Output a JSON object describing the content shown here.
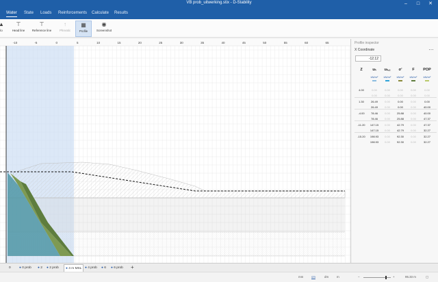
{
  "window": {
    "title": "VB prob_uitwerking.stix - D-Stability"
  },
  "menu": {
    "items": [
      "Water",
      "State",
      "Loads",
      "Reinforcements",
      "Calculate",
      "Results"
    ],
    "active": "Water"
  },
  "ribbon": {
    "items": [
      {
        "label": "lo",
        "icon": "phreatic-line-icon"
      },
      {
        "label": "Head line",
        "icon": "head-line-icon"
      },
      {
        "label": "Reference line",
        "icon": "reference-line-icon"
      },
      {
        "label": "Phreatic",
        "icon": "phreatic-icon"
      },
      {
        "label": "Profile",
        "icon": "profile-icon"
      },
      {
        "label": "Screenshot",
        "icon": "camera-icon"
      }
    ]
  },
  "ruler": {
    "ticks": [
      "-10",
      "-5",
      "0",
      "5",
      "10",
      "15",
      "20",
      "25",
      "30",
      "35",
      "40",
      "45",
      "50",
      "55",
      "60",
      "65"
    ]
  },
  "profile_inspector": {
    "title": "Profile inspector",
    "coordinate_label": "X Coordinate",
    "coordinate_value": "-12.12",
    "columns": [
      {
        "name": "Z",
        "unit": "",
        "color": ""
      },
      {
        "name": "uₕ",
        "unit": "kN/m²",
        "color": "#8bbce0"
      },
      {
        "name": "uₕ,ₑ",
        "unit": "kN/m²",
        "color": "#2ea3d8"
      },
      {
        "name": "σ'",
        "unit": "kN/m²",
        "color": "#8a8a3a"
      },
      {
        "name": "F",
        "unit": "kN/m²",
        "color": "#5e7d3e"
      },
      {
        "name": "POP",
        "unit": "kN/m²",
        "color": "#b9c96a"
      }
    ],
    "rows": [
      [
        "4.00",
        "0.00",
        "0.00",
        "0.00",
        "0.00",
        "0.00"
      ],
      [
        "",
        "0.00",
        "0.00",
        "0.00",
        "0.00",
        "0.00"
      ],
      [
        "1.30",
        "26.49",
        "0.00",
        "0.00",
        "0.00",
        "0.00"
      ],
      [
        "",
        "26.49",
        "0.00",
        "0.00",
        "0.00",
        "40.00"
      ],
      [
        "-4.00",
        "78.46",
        "0.00",
        "25.88",
        "0.00",
        "40.00"
      ],
      [
        "",
        "78.46",
        "0.00",
        "25.88",
        "0.00",
        "47.37"
      ],
      [
        "-11.20",
        "147.15",
        "0.00",
        "42.79",
        "0.00",
        "47.37"
      ],
      [
        "",
        "147.15",
        "0.00",
        "42.79",
        "0.00",
        "32.27"
      ],
      [
        "-15.20",
        "198.93",
        "0.00",
        "92.30",
        "0.00",
        "32.27"
      ],
      [
        "",
        "198.93",
        "0.00",
        "92.30",
        "0.00",
        "32.27"
      ]
    ],
    "dim_columns": [
      2,
      4
    ]
  },
  "bottom_tabs": {
    "items": [
      "0",
      "0 prob",
      "2",
      "2 prob",
      "4 m MSL",
      "4 prob",
      "6",
      "6 prob"
    ],
    "active": "4 m MSL"
  },
  "status": {
    "units": [
      "mm",
      "cm",
      "dm",
      "m"
    ],
    "selected_unit": "cm",
    "zoom": "95.33 m"
  }
}
